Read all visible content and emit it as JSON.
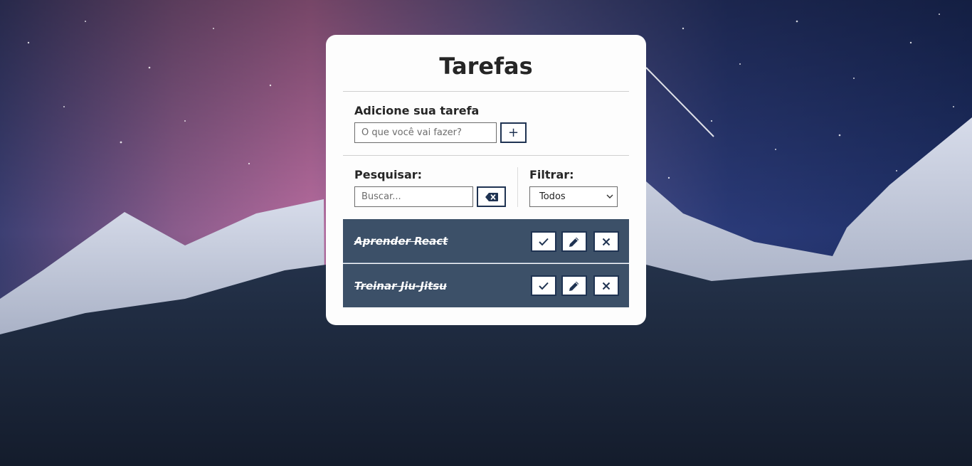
{
  "app": {
    "title": "Tarefas"
  },
  "add_section": {
    "label": "Adicione sua tarefa",
    "input_placeholder": "O que você vai fazer?",
    "input_value": "",
    "add_button_label": "+"
  },
  "search_section": {
    "label": "Pesquisar:",
    "input_placeholder": "Buscar...",
    "input_value": "",
    "clear_icon": "backspace-icon"
  },
  "filter_section": {
    "label": "Filtrar:",
    "selected": "Todos"
  },
  "todos": [
    {
      "text": "Aprender React",
      "done": true
    },
    {
      "text": "Treinar Jiu-Jitsu",
      "done": true
    }
  ],
  "todo_actions": {
    "complete_icon": "check-icon",
    "edit_icon": "pencil-icon",
    "remove_icon": "close-icon"
  },
  "colors": {
    "card_bg": "#fdfdfd",
    "accent": "#1f3352",
    "todo_bg": "#3c5068"
  }
}
